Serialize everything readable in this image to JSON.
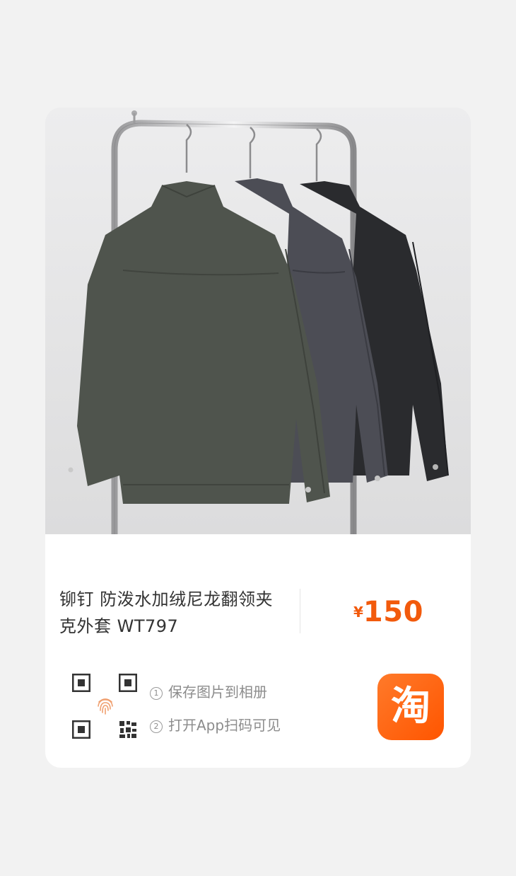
{
  "product": {
    "title": "铆钉 防泼水加绒尼龙翻领夹克外套 WT797",
    "image_alt": "三件翻领夹克挂在金属衣架上"
  },
  "price": {
    "currency": "¥",
    "value": "150"
  },
  "steps": [
    {
      "index": "1",
      "text": "保存图片到相册"
    },
    {
      "index": "2",
      "text": "打开App扫码可见"
    }
  ],
  "app_badge": {
    "label": "淘"
  },
  "colors": {
    "price": "#f25a0c",
    "brand": "#ff5500",
    "fingerprint": "#f0a070"
  }
}
